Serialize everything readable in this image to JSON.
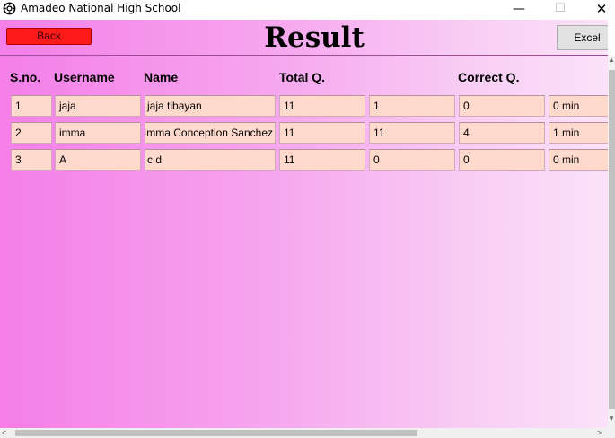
{
  "window": {
    "title": "Amadeo National High School",
    "icon": "gear-icon",
    "minimize_glyph": "—",
    "maximize_glyph": "☐",
    "close_glyph": "✕"
  },
  "toolbar": {
    "back_label": "Back",
    "title": "Result",
    "excel_label": "Excel"
  },
  "table": {
    "headers": {
      "sno": "S.no.",
      "username": "Username",
      "name": "Name",
      "total": "Total Q.",
      "correct": "Correct Q."
    },
    "rows": [
      [
        "1",
        "jaja",
        "jaja tibayan",
        "11",
        "1",
        "0",
        "0 min"
      ],
      [
        "2",
        "imma",
        "Imma Conception Sanchez",
        "11",
        "11",
        "4",
        "1 min"
      ],
      [
        "3",
        "A",
        "c d",
        "11",
        "0",
        "0",
        "0 min"
      ]
    ]
  },
  "scrollbars": {
    "up_arrow": "▲",
    "down_arrow": "▼",
    "left_arrow": "<",
    "right_arrow": ">"
  },
  "colors": {
    "back_button": "#ff1a1a",
    "cell_background": "#ffd9cc",
    "gradient_left": "#f47fe8",
    "gradient_right": "#fbe2f8"
  }
}
